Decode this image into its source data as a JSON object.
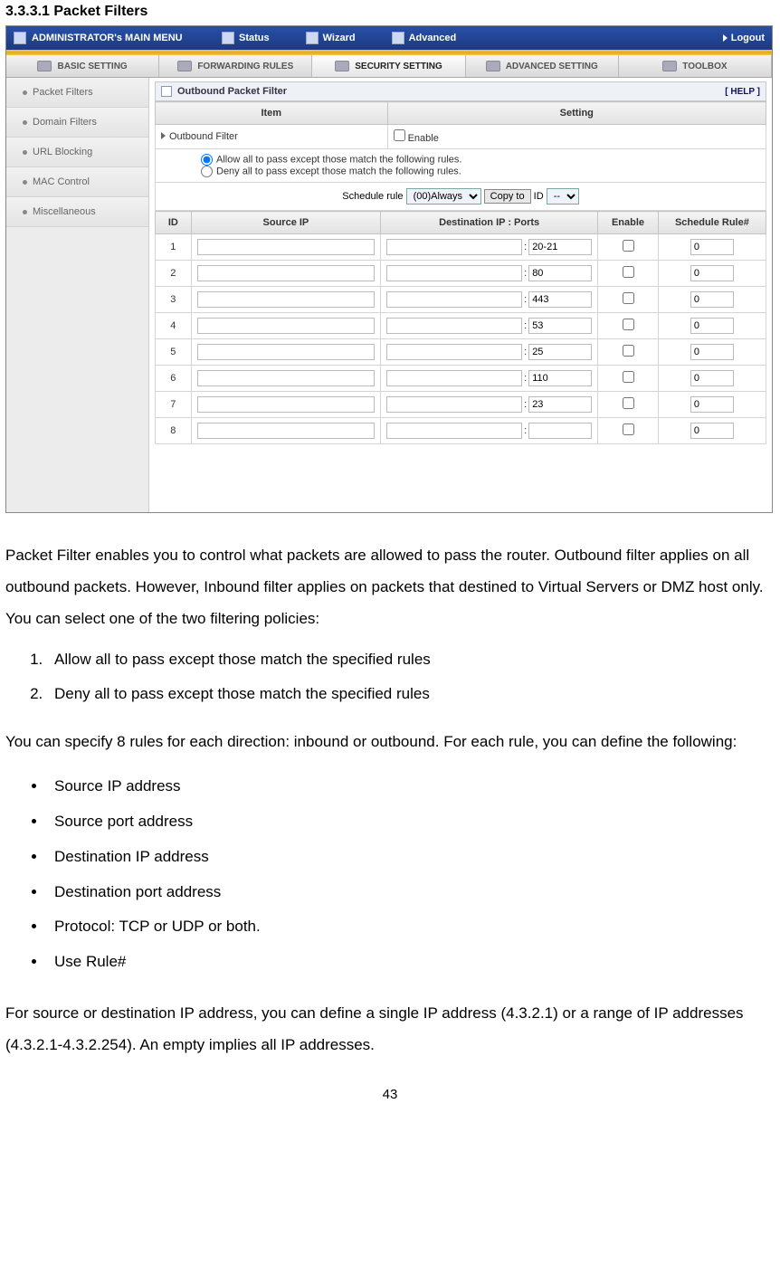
{
  "section_heading": "3.3.3.1 Packet Filters",
  "topbar": {
    "main_label": "ADMINISTRATOR's MAIN MENU",
    "items": [
      "Status",
      "Wizard",
      "Advanced"
    ],
    "logout": "Logout"
  },
  "tabs": {
    "labels": [
      "BASIC SETTING",
      "FORWARDING RULES",
      "SECURITY SETTING",
      "ADVANCED SETTING",
      "TOOLBOX"
    ],
    "active_index": 2
  },
  "sidebar": {
    "items": [
      "Packet Filters",
      "Domain Filters",
      "URL Blocking",
      "MAC Control",
      "Miscellaneous"
    ]
  },
  "panel": {
    "title": "Outbound Packet Filter",
    "help_label": "[ HELP ]",
    "header_item": "Item",
    "header_setting": "Setting",
    "outbound_filter_label": "Outbound Filter",
    "enable_label": "Enable",
    "radio_allow": "Allow all to pass except those match the following rules.",
    "radio_deny": "Deny all to pass except those match the following rules.",
    "schedule_label": "Schedule rule",
    "schedule_select": "(00)Always",
    "copy_to_btn": "Copy to",
    "id_label": "ID",
    "id_select": "--"
  },
  "rules_table": {
    "headers": [
      "ID",
      "Source IP",
      "Destination IP : Ports",
      "Enable",
      "Schedule Rule#"
    ],
    "rows": [
      {
        "id": "1",
        "src": "",
        "dst_ip": "",
        "dst_port": "20-21",
        "enable": false,
        "sched": "0"
      },
      {
        "id": "2",
        "src": "",
        "dst_ip": "",
        "dst_port": "80",
        "enable": false,
        "sched": "0"
      },
      {
        "id": "3",
        "src": "",
        "dst_ip": "",
        "dst_port": "443",
        "enable": false,
        "sched": "0"
      },
      {
        "id": "4",
        "src": "",
        "dst_ip": "",
        "dst_port": "53",
        "enable": false,
        "sched": "0"
      },
      {
        "id": "5",
        "src": "",
        "dst_ip": "",
        "dst_port": "25",
        "enable": false,
        "sched": "0"
      },
      {
        "id": "6",
        "src": "",
        "dst_ip": "",
        "dst_port": "110",
        "enable": false,
        "sched": "0"
      },
      {
        "id": "7",
        "src": "",
        "dst_ip": "",
        "dst_port": "23",
        "enable": false,
        "sched": "0"
      },
      {
        "id": "8",
        "src": "",
        "dst_ip": "",
        "dst_port": "",
        "enable": false,
        "sched": "0"
      }
    ]
  },
  "doc": {
    "para1": "Packet Filter enables you to control what packets are allowed to pass the router. Outbound filter applies on all outbound packets. However, Inbound filter applies on packets that destined to Virtual Servers or DMZ host only. You can select one of the two filtering policies:",
    "ol": [
      "Allow all to pass except those match the specified rules",
      "Deny all to pass except those match the specified rules"
    ],
    "para2": "You can specify 8 rules for each direction: inbound or outbound. For each rule, you can define the following:",
    "ul": [
      "Source IP address",
      "Source port address",
      "Destination IP address",
      "Destination port address",
      "Protocol: TCP or UDP or both.",
      "Use Rule#"
    ],
    "para3": "For source or destination IP address, you can define a single IP address (4.3.2.1) or a range of IP addresses (4.3.2.1-4.3.2.254). An empty implies all IP addresses."
  },
  "page_number": "43"
}
